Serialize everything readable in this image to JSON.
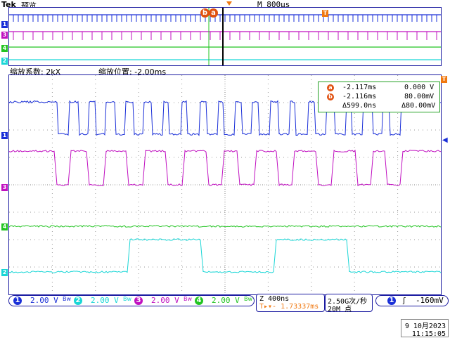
{
  "brand": "Tek",
  "mode": "预览",
  "timebase_main": "M 800µs",
  "zoom_factor_label": "缩放系数: 2kX",
  "zoom_position_label": "缩放位置: -2.00ms",
  "cursor_readout": {
    "a_label": "a",
    "a_time": "-2.117ms",
    "a_value": "0.000 V",
    "b_label": "b",
    "b_time": "-2.116ms",
    "b_value": "80.00mV",
    "delta_time": "Δ599.0ns",
    "delta_value": "Δ80.00mV"
  },
  "channels": [
    {
      "num": "1",
      "scale": "2.00 V",
      "color": "#1a2fd8"
    },
    {
      "num": "2",
      "scale": "2.00 V",
      "color": "#19d6d6"
    },
    {
      "num": "3",
      "scale": "2.00 V",
      "color": "#c010c0"
    },
    {
      "num": "4",
      "scale": "2.00 V",
      "color": "#22c422"
    }
  ],
  "zoom_timebase": "Z 400ns",
  "trigger_offset": "T▸▾- 1.73337ms",
  "sample_rate": "2.50G次/秒",
  "record_length": "20M 点",
  "trigger": {
    "channel": "1",
    "slope": "ʃ",
    "level": "-160mV"
  },
  "date": "9 10月2023",
  "time": "11:15:05",
  "colors": {
    "grid": "#9a9a9a",
    "border": "#1a1aa0",
    "cursor": "#e05010",
    "trigger": "#f07810"
  }
}
